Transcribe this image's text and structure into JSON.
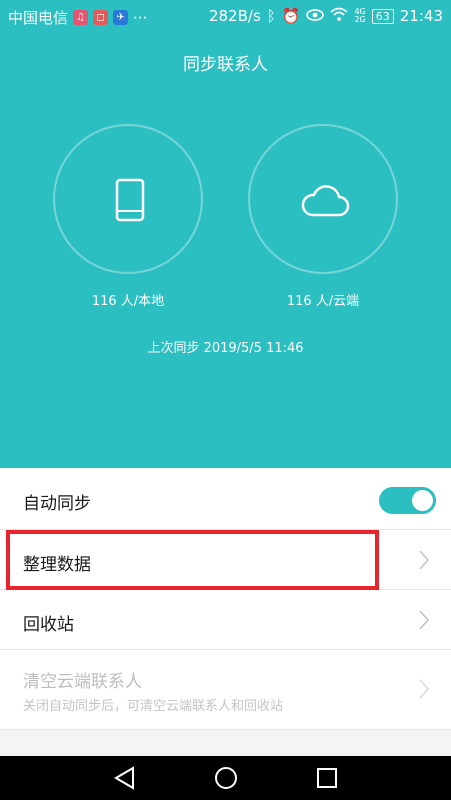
{
  "status_bar": {
    "carrier": "中国电信",
    "more": "···",
    "network_speed": "282B/s",
    "signal_type": "4G",
    "signal_type2": "2G",
    "battery": "63",
    "time": "21:43"
  },
  "header": {
    "title": "同步联系人"
  },
  "sync": {
    "local_count": "116 人/本地",
    "cloud_count": "116 人/云端",
    "last_sync": "上次同步 2019/5/5 11:46"
  },
  "settings": {
    "auto_sync_label": "自动同步",
    "auto_sync_on": true,
    "organize_label": "整理数据",
    "recycle_label": "回收站",
    "clear_cloud_label": "清空云端联系人",
    "clear_cloud_sub": "关闭自动同步后，可清空云端联系人和回收站"
  },
  "icons": {
    "phone": "phone-icon",
    "cloud": "cloud-icon",
    "chevron": "chevron-right-icon",
    "back": "nav-back-icon",
    "home": "nav-home-icon",
    "recents": "nav-recents-icon"
  },
  "colors": {
    "accent": "#2cbfc2",
    "highlight": "#e8242f"
  }
}
